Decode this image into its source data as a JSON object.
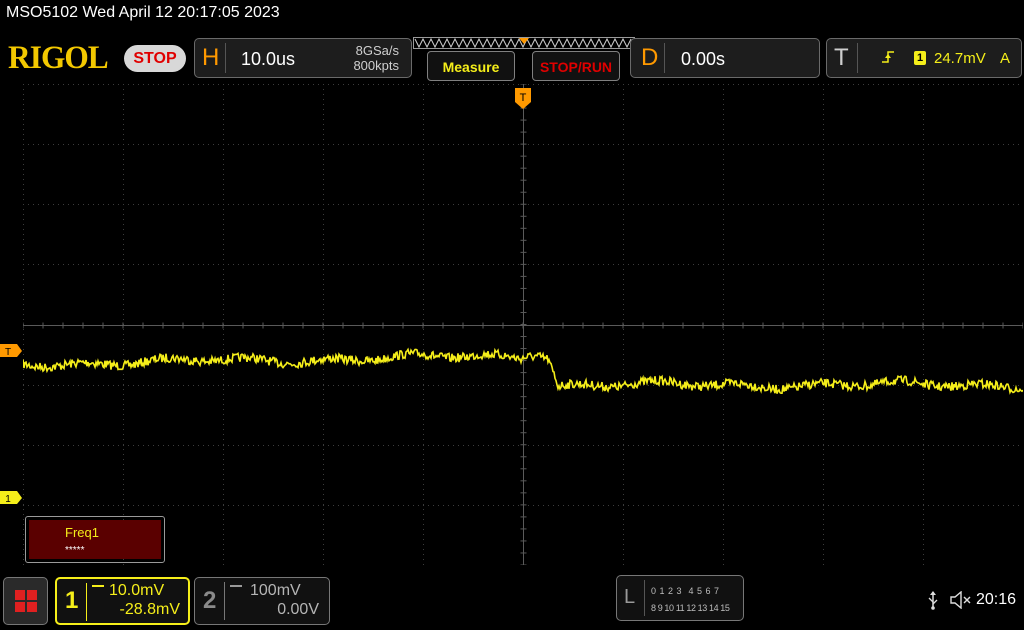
{
  "header": {
    "device_timestamp": "MSO5102  Wed April 12 20:17:05 2023",
    "logo_text": "RIGOL",
    "run_state": "STOP"
  },
  "horizontal": {
    "label": "H",
    "timebase": "10.0us",
    "sample_rate": "8GSa/s",
    "memory_depth": "800kpts"
  },
  "buttons": {
    "measure": "Measure",
    "stop_run": "STOP/RUN"
  },
  "delay": {
    "label": "D",
    "value": "0.00s"
  },
  "trigger": {
    "label": "T",
    "channel": "1",
    "level": "24.7mV",
    "mode": "A",
    "marker": "T"
  },
  "channel1": {
    "number": "1",
    "scale": "10.0mV",
    "offset": "-28.8mV",
    "ground_marker": "1",
    "color": "#f5ee1a"
  },
  "channel2": {
    "number": "2",
    "scale": "100mV",
    "offset": "0.00V"
  },
  "measurement": {
    "name": "Freq1",
    "value": "*****"
  },
  "logic": {
    "label": "L",
    "row1": "0 1 2 3  4 5 6 7",
    "row2": "8 9 10 11 12 13 14 15"
  },
  "status": {
    "clock": "20:16"
  },
  "colors": {
    "accent_orange": "#ff9900",
    "ch1_yellow": "#f5ee1a",
    "stop_red": "#e00000"
  }
}
